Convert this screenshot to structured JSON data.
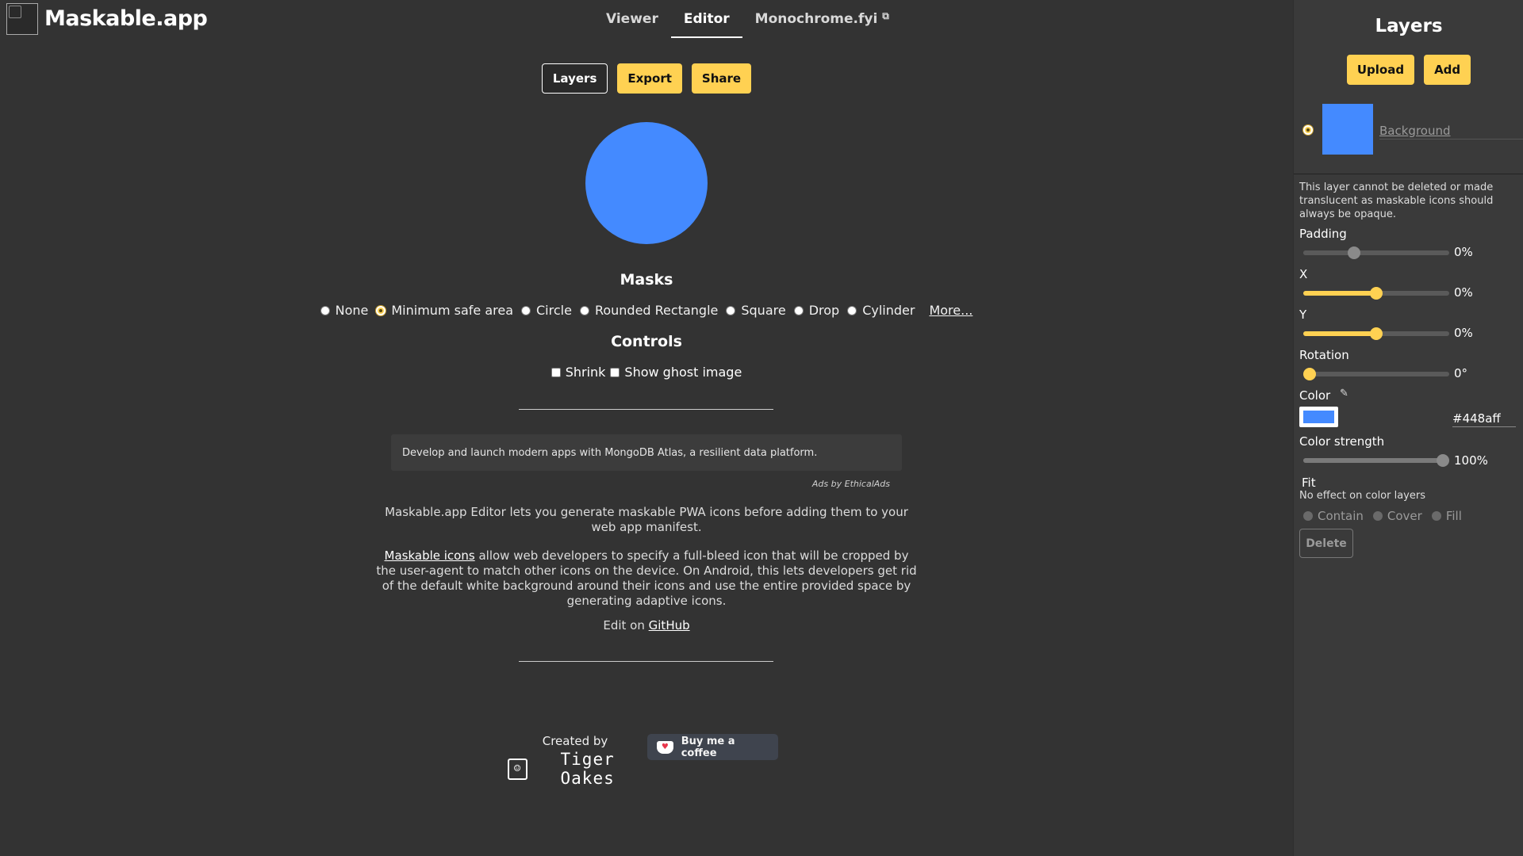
{
  "header": {
    "app_title": "Maskable.app",
    "tabs": [
      {
        "label": "Viewer"
      },
      {
        "label": "Editor"
      },
      {
        "label": "Monochrome.fyi"
      }
    ]
  },
  "toolbar": {
    "layers_label": "Layers",
    "export_label": "Export",
    "share_label": "Share"
  },
  "preview": {
    "color": "#448aff"
  },
  "masks": {
    "title": "Masks",
    "options": [
      "None",
      "Minimum safe area",
      "Circle",
      "Rounded Rectangle",
      "Square",
      "Drop",
      "Cylinder"
    ],
    "selected": "Minimum safe area",
    "more_label": "More..."
  },
  "controls": {
    "title": "Controls",
    "shrink_label": "Shrink",
    "ghost_label": "Show ghost image"
  },
  "ad": {
    "text": "Develop and launch modern apps with MongoDB Atlas, a resilient data platform.",
    "credit": "Ads by EthicalAds"
  },
  "about": {
    "intro": "Maskable.app Editor lets you generate maskable PWA icons before adding them to your web app manifest.",
    "maskable_link": "Maskable icons",
    "body": " allow web developers to specify a full-bleed icon that will be cropped by the user-agent to match other icons on the device. On Android, this lets developers get rid of the default white background around their icons and use the entire provided space by generating adaptive icons.",
    "edit_prefix": "Edit on ",
    "github_link": "GitHub"
  },
  "footer": {
    "created_by": "Created by",
    "author": "Tiger Oakes",
    "coffee_label": "Buy me a coffee"
  },
  "panel": {
    "title": "Layers",
    "upload_label": "Upload",
    "add_label": "Add",
    "layer": {
      "name": "Background",
      "color": "#448aff"
    },
    "note": "This layer cannot be deleted or made translucent as maskable icons should always be opaque.",
    "padding": {
      "label": "Padding",
      "value_text": "0%",
      "fraction": 0.35
    },
    "x": {
      "label": "X",
      "value_text": "0%",
      "fraction": 0.5
    },
    "y": {
      "label": "Y",
      "value_text": "0%",
      "fraction": 0.5
    },
    "rotation": {
      "label": "Rotation",
      "value_text": "0°",
      "fraction": 0.0
    },
    "color": {
      "label": "Color",
      "hex": "#448aff"
    },
    "strength": {
      "label": "Color strength",
      "value_text": "100%",
      "fraction": 1.0
    },
    "fit": {
      "label": "Fit",
      "note": "No effect on color layers",
      "options": [
        "Contain",
        "Cover",
        "Fill"
      ]
    },
    "delete_label": "Delete"
  },
  "colors": {
    "accent": "#ffd152",
    "background": "#333333",
    "panel": "#3a3a3a"
  }
}
